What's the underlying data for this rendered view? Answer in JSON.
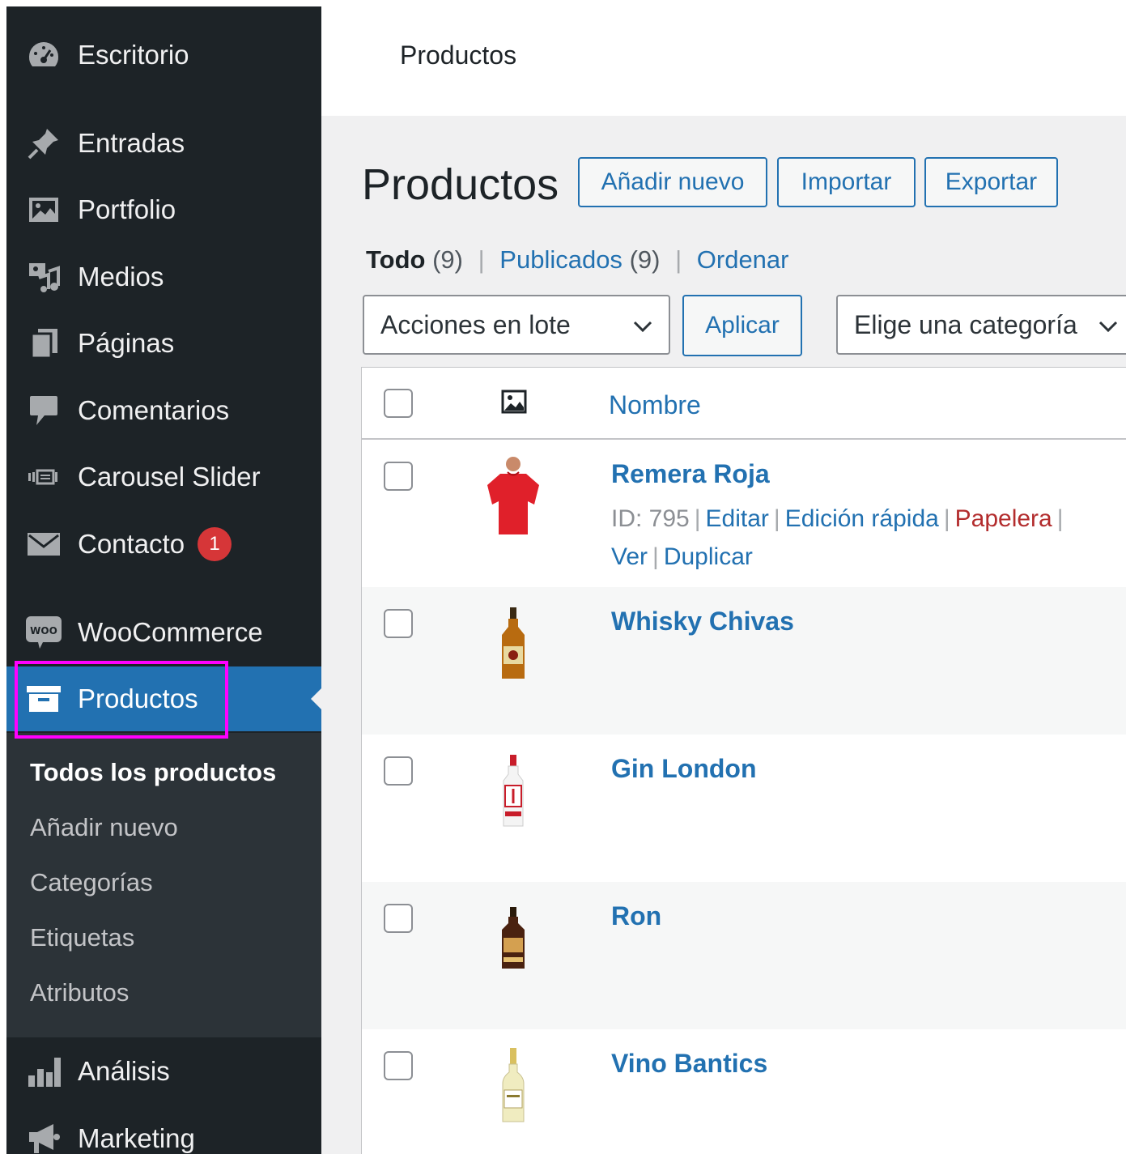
{
  "sidebar": {
    "items": [
      {
        "label": "Escritorio",
        "icon": "dashboard-icon"
      },
      {
        "label": "Entradas",
        "icon": "pin-icon"
      },
      {
        "label": "Portfolio",
        "icon": "image-icon"
      },
      {
        "label": "Medios",
        "icon": "media-icon"
      },
      {
        "label": "Páginas",
        "icon": "pages-icon"
      },
      {
        "label": "Comentarios",
        "icon": "comment-icon"
      },
      {
        "label": "Carousel Slider",
        "icon": "slider-icon"
      },
      {
        "label": "Contacto",
        "icon": "mail-icon",
        "badge": "1"
      },
      {
        "label": "WooCommerce",
        "icon": "woo-icon"
      },
      {
        "label": "Productos",
        "icon": "archive-icon"
      },
      {
        "label": "Análisis",
        "icon": "bar-chart-icon"
      },
      {
        "label": "Marketing",
        "icon": "megaphone-icon"
      }
    ],
    "submenu": [
      {
        "label": "Todos los productos"
      },
      {
        "label": "Añadir nuevo"
      },
      {
        "label": "Categorías"
      },
      {
        "label": "Etiquetas"
      },
      {
        "label": "Atributos"
      }
    ],
    "highlight_color": "#ff00ff",
    "accent_color": "#2271b1",
    "background_color": "#1d2327"
  },
  "topbar": {
    "title": "Productos"
  },
  "main": {
    "title": "Productos",
    "buttons": {
      "add_new": "Añadir nuevo",
      "import": "Importar",
      "export": "Exportar"
    },
    "filters": {
      "all_label": "Todo",
      "all_count": "(9)",
      "published_label": "Publicados",
      "published_count": "(9)",
      "sort_label": "Ordenar",
      "separator": "|"
    },
    "bulk_actions": {
      "selected": "Acciones en lote",
      "apply": "Aplicar"
    },
    "category_filter": {
      "selected": "Elige una categoría"
    },
    "table": {
      "header_name": "Nombre",
      "rows": [
        {
          "name": "Remera Roja",
          "id_label": "ID: 795",
          "actions": [
            "Editar",
            "Edición rápida",
            "Papelera",
            "Ver",
            "Duplicar"
          ],
          "thumb": "red-shirt"
        },
        {
          "name": "Whisky Chivas",
          "thumb": "whisky-bottle"
        },
        {
          "name": "Gin London",
          "thumb": "gin-bottle"
        },
        {
          "name": "Ron",
          "thumb": "rum-bottle"
        },
        {
          "name": "Vino Bantics",
          "thumb": "wine-bottle"
        }
      ]
    }
  }
}
